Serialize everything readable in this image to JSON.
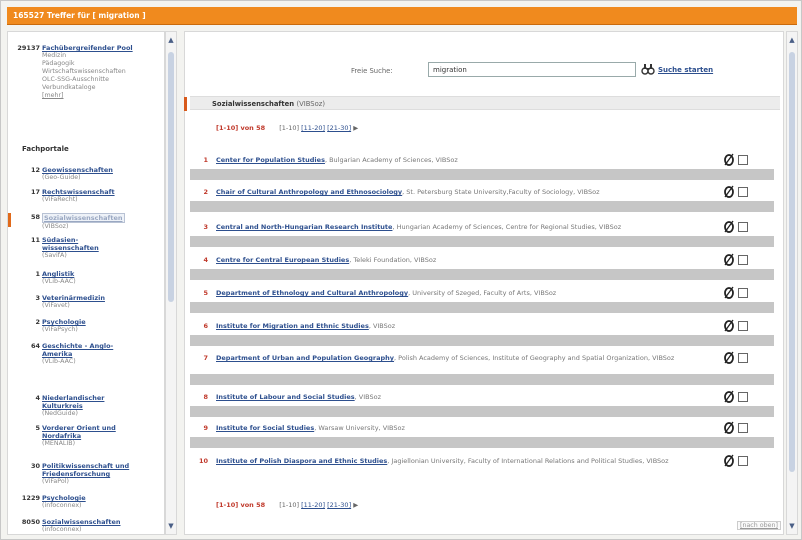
{
  "header": {
    "title": "165527 Treffer für [ migration ]"
  },
  "left": {
    "pool": {
      "count": "29137",
      "label": "Fachübergreifender Pool",
      "subs": [
        "Medizin",
        "Pädagogik",
        "Wirtschaftswissenschaften",
        "OLC-SSG-Ausschnitte",
        "Verbundkataloge"
      ],
      "more": "[mehr]"
    },
    "fachportale_title": "Fachportale",
    "items": [
      {
        "count": "12",
        "label": "Geowissenschaften",
        "sub": "(Geo-Guide)"
      },
      {
        "count": "17",
        "label": "Rechtswissenschaft",
        "sub": "(ViFaRecht)"
      },
      {
        "count": "58",
        "label": "Sozialwissenschaften",
        "sub": "(VIBSoz)"
      },
      {
        "count": "11",
        "label": "Südasien-wissenschaften",
        "sub": "(SavifA)"
      },
      {
        "count": "1",
        "label": "Anglistik",
        "sub": "(VLib-AAC)"
      },
      {
        "count": "3",
        "label": "Veterinärmedizin",
        "sub": "(ViFavet)"
      },
      {
        "count": "2",
        "label": "Psychologie",
        "sub": "(ViFaPsych)"
      },
      {
        "count": "64",
        "label": "Geschichte - Anglo- Amerika",
        "sub": "(VLib-AAC)"
      },
      {
        "count": "4",
        "label": "Niederlandischer Kulturkreis",
        "sub": "(NedGuide)"
      },
      {
        "count": "5",
        "label": "Vorderer Orient und Nordafrika",
        "sub": "(MENALIB)"
      },
      {
        "count": "30",
        "label": "Politikwissenschaft und Friedensforschung",
        "sub": "(ViFaPol)"
      },
      {
        "count": "1229",
        "label": "Psychologie",
        "sub": "(infoconnex)"
      },
      {
        "count": "8050",
        "label": "Sozialwissenschaften",
        "sub": "(infoconnex)"
      }
    ]
  },
  "search": {
    "label": "Freie Suche:",
    "value": "migration",
    "button": "Suche starten"
  },
  "section": {
    "title": "Sozialwissenschaften",
    "sub": "(VIBSoz)"
  },
  "pager": {
    "current": "[1-10] von 58",
    "range": "[1-10]",
    "p2": "[11-20]",
    "p3": "[21-30]",
    "arrow": "▶"
  },
  "results": [
    {
      "n": "1",
      "title": "Center for Population Studies",
      "desc": ", Bulgarian Academy of Sciences, VIBSoz"
    },
    {
      "n": "2",
      "title": "Chair of Cultural Anthropology and Ethnosociology",
      "desc": ", St. Petersburg State University,Faculty of Sociology, VIBSoz"
    },
    {
      "n": "3",
      "title": "Central and North-Hungarian Research Institute",
      "desc": ", Hungarian Academy of Sciences, Centre for Regional Studies, VIBSoz"
    },
    {
      "n": "4",
      "title": "Centre for Central European Studies",
      "desc": ", Teleki Foundation, VIBSoz"
    },
    {
      "n": "5",
      "title": "Department of Ethnology and Cultural Anthropology",
      "desc": ", University of Szeged, Faculty of Arts, VIBSoz"
    },
    {
      "n": "6",
      "title": "Institute for Migration and Ethnic Studies",
      "desc": ", VIBSoz"
    },
    {
      "n": "7",
      "title": "Department of Urban and Population Geography",
      "desc": ", Polish Academy of Sciences, Institute of Geography and Spatial Organization, VIBSoz"
    },
    {
      "n": "8",
      "title": "Institute of Labour and Social Studies",
      "desc": ", VIBSoz"
    },
    {
      "n": "9",
      "title": "Institute for Social Studies",
      "desc": ", Warsaw University, VIBSoz"
    },
    {
      "n": "10",
      "title": "Institute of Polish Diaspora and Ethnic Studies",
      "desc": ", Jagiellonian University, Faculty of International Relations and Political Studies, VIBSoz"
    }
  ],
  "footer": {
    "top": "[nach oben]"
  },
  "colors": {
    "accent": "#f08a1e",
    "link": "#2d4f8e",
    "active": "#c0392b"
  }
}
